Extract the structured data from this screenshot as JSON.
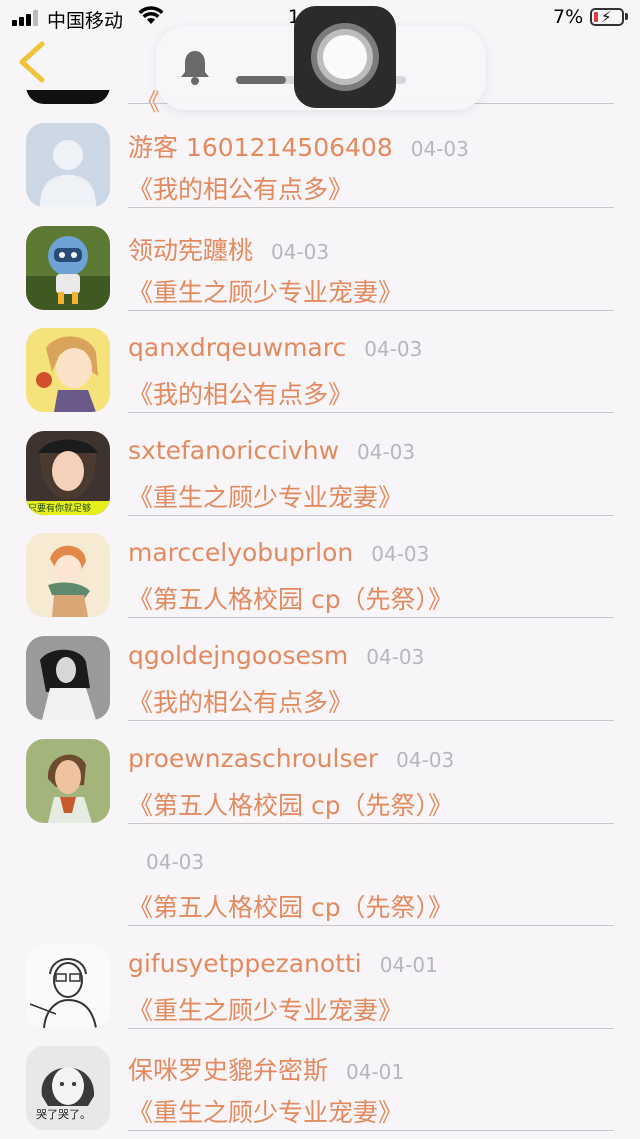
{
  "status_bar": {
    "carrier": "中国移动",
    "time": "1",
    "battery": "7%"
  },
  "nav": {
    "back_icon": "chevron-left-icon"
  },
  "overlay": {
    "bell_icon": "bell-icon",
    "volume": 0.3
  },
  "partial_row": {
    "title": "《"
  },
  "colors": {
    "accent": "#e38a5f",
    "date": "#b9b6bb",
    "back": "#f0c33b"
  },
  "comments": [
    {
      "name": "游客 1601214506408",
      "date": "04-03",
      "title": "《我的相公有点多》",
      "avatar": "default-user"
    },
    {
      "name": "领动宪躔桃",
      "date": "04-03",
      "title": "《重生之顾少专业宠妻》",
      "avatar": "robot-toy"
    },
    {
      "name": "qanxdrqeuwmarc",
      "date": "04-03",
      "title": "《我的相公有点多》",
      "avatar": "anime-boy"
    },
    {
      "name": "sxtefanoriccivhw",
      "date": "04-03",
      "title": "《重生之顾少专业宠妻》",
      "avatar": "girl-hat"
    },
    {
      "name": "marccelyobuprlon",
      "date": "04-03",
      "title": "《第五人格校园 cp（先祭）》",
      "avatar": "anime-scarf"
    },
    {
      "name": "qgoldejngoosesm",
      "date": "04-03",
      "title": "《我的相公有点多》",
      "avatar": "bw-girl"
    },
    {
      "name": "proewnzaschroulser",
      "date": "04-03",
      "title": "《第五人格校园 cp（先祭）》",
      "avatar": "woman-green"
    },
    {
      "name": "",
      "date": "04-03",
      "title": "《第五人格校园 cp（先祭）》",
      "avatar": ""
    },
    {
      "name": "gifusyetppezanotti",
      "date": "04-01",
      "title": "《重生之顾少专业宠妻》",
      "avatar": "sketch-boy"
    },
    {
      "name": "保咪罗史貔弁密斯",
      "date": "04-01",
      "title": "《重生之顾少专业宠妻》",
      "avatar": "girl-caption"
    }
  ],
  "avatar_captions": {
    "girl-hat": "只要有你就足够",
    "girl-caption": "哭了哭了。"
  }
}
